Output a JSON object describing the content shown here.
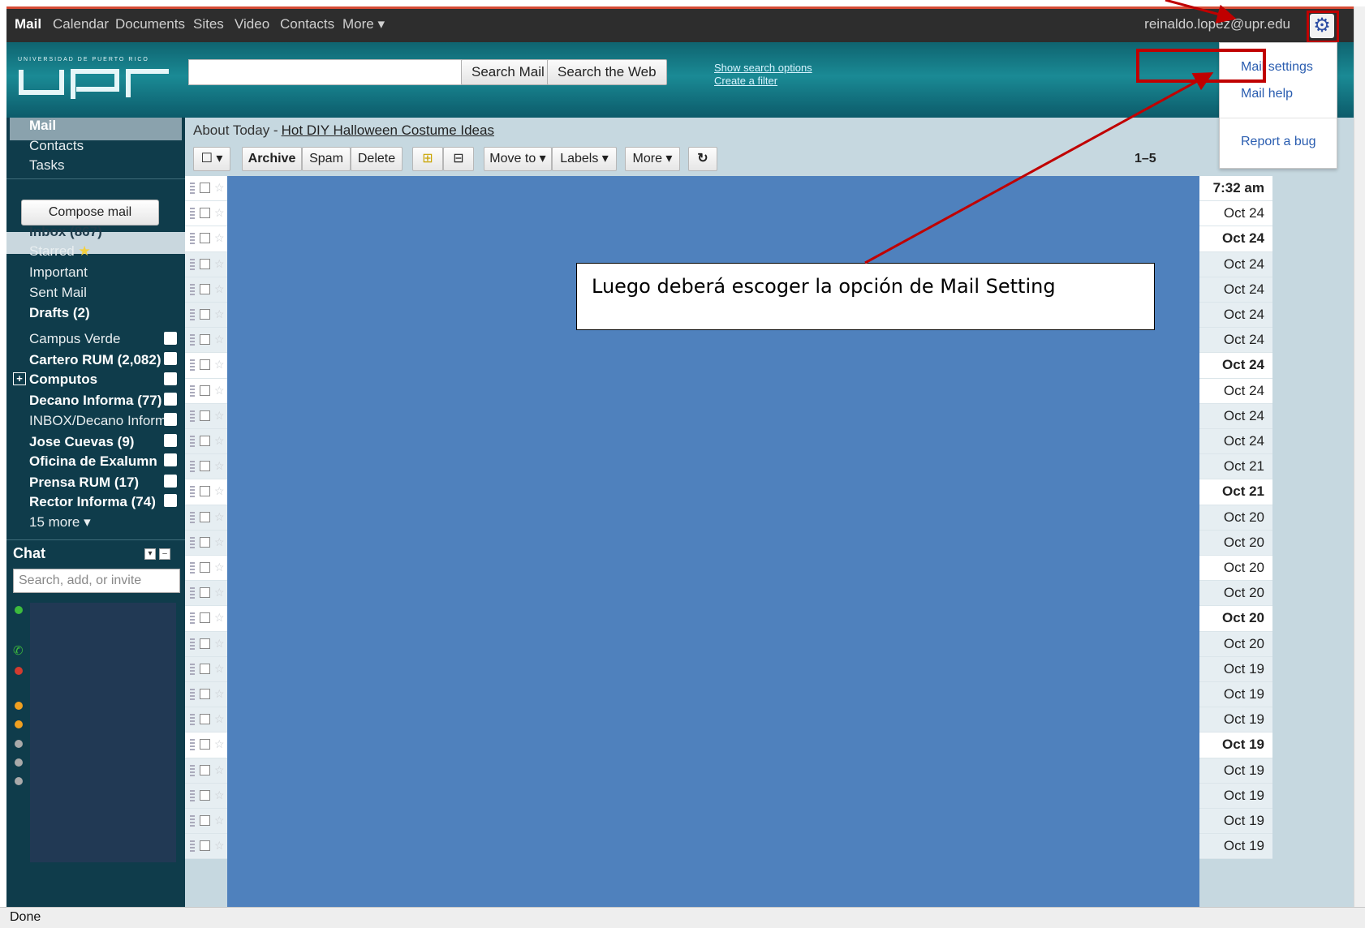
{
  "topnav": {
    "items": [
      "Mail",
      "Calendar",
      "Documents",
      "Sites",
      "Video",
      "Contacts",
      "More ▾"
    ],
    "account": "reinaldo.lopez@upr.edu",
    "gear_icon": "gear-icon"
  },
  "header": {
    "logo_ribbon": "UNIVERSIDAD DE PUERTO RICO",
    "logo_text": "upr",
    "search_mail": "Search Mail",
    "search_web": "Search the Web",
    "show_options": "Show search options",
    "create_filter": "Create a filter"
  },
  "leftnav": {
    "mail": "Mail",
    "contacts": "Contacts",
    "tasks": "Tasks",
    "compose": "Compose mail",
    "inbox": "Inbox (867)",
    "starred": "Starred",
    "important": "Important",
    "sent": "Sent Mail",
    "drafts": "Drafts (2)",
    "labels": [
      "Campus Verde",
      "Cartero RUM (2,082)",
      "Computos",
      "Decano Informa (77)",
      "INBOX/Decano Inform",
      "Jose Cuevas (9)",
      "Oficina de Exalumn",
      "Prensa RUM (17)",
      "Rector Informa (74)"
    ],
    "more": "15 more ▾",
    "chat": "Chat",
    "chat_placeholder": "Search, add, or invite"
  },
  "main": {
    "about_prefix": "About Today -",
    "about_link": "Hot DIY Halloween Costume Ideas",
    "toolbar": {
      "archive": "Archive",
      "spam": "Spam",
      "delete": "Delete",
      "move_to": "Move to ▾",
      "labels": "Labels ▾",
      "more": "More ▾",
      "refresh_icon": "↻"
    },
    "counter": "1–5",
    "dates": [
      "7:32 am",
      "Oct 24",
      "Oct 24",
      "Oct 24",
      "Oct 24",
      "Oct 24",
      "Oct 24",
      "Oct 24",
      "Oct 24",
      "Oct 24",
      "Oct 24",
      "Oct 21",
      "Oct 21",
      "Oct 20",
      "Oct 20",
      "Oct 20",
      "Oct 20",
      "Oct 20",
      "Oct 20",
      "Oct 19",
      "Oct 19",
      "Oct 19",
      "Oct 19",
      "Oct 19",
      "Oct 19",
      "Oct 19",
      "Oct 19"
    ]
  },
  "dropdown": {
    "mail_settings": "Mail settings",
    "mail_help": "Mail help",
    "report_bug": "Report a bug"
  },
  "callout": "Luego deberá escoger la opción de Mail Setting",
  "status": "Done",
  "colors": {
    "annotation_red": "#c00000",
    "redaction_blue": "#4f81bd",
    "nav_dark": "#2d2d2d"
  }
}
